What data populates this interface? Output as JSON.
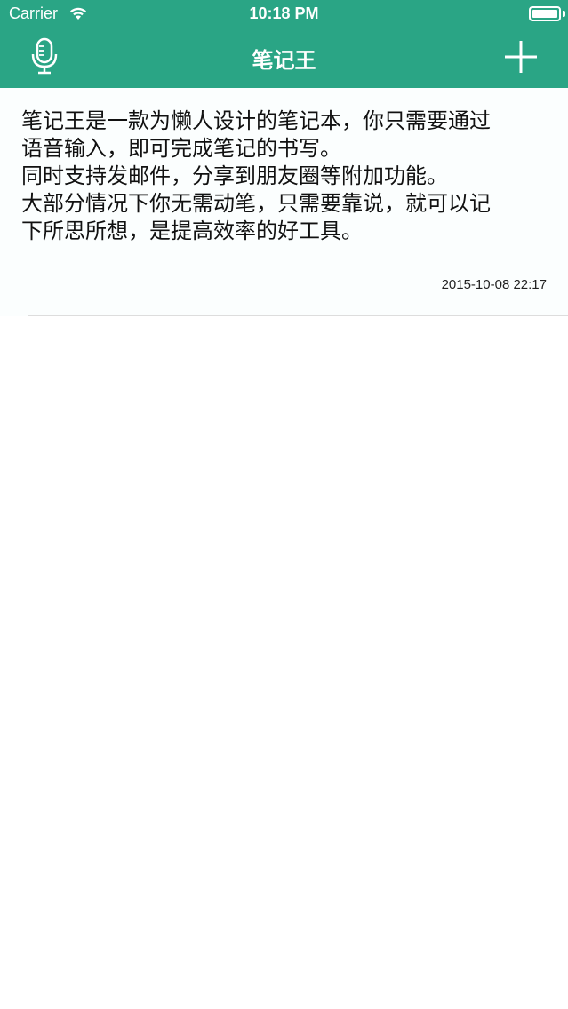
{
  "status_bar": {
    "carrier": "Carrier",
    "time": "10:18 PM",
    "wifi_icon": "wifi-icon",
    "battery_icon": "battery-icon"
  },
  "navbar": {
    "title": "笔记王",
    "left_icon": "microphone-icon",
    "right_icon": "plus-icon",
    "background_color": "#2aa585"
  },
  "notes": [
    {
      "body": "笔记王是一款为懒人设计的笔记本，你只需要通过\n语音输入，即可完成笔记的书写。\n同时支持发邮件，分享到朋友圈等附加功能。\n大部分情况下你无需动笔，只需要靠说，就可以记\n下所思所想，是提高效率的好工具。",
      "date": "2015-10-08 22:17"
    }
  ]
}
